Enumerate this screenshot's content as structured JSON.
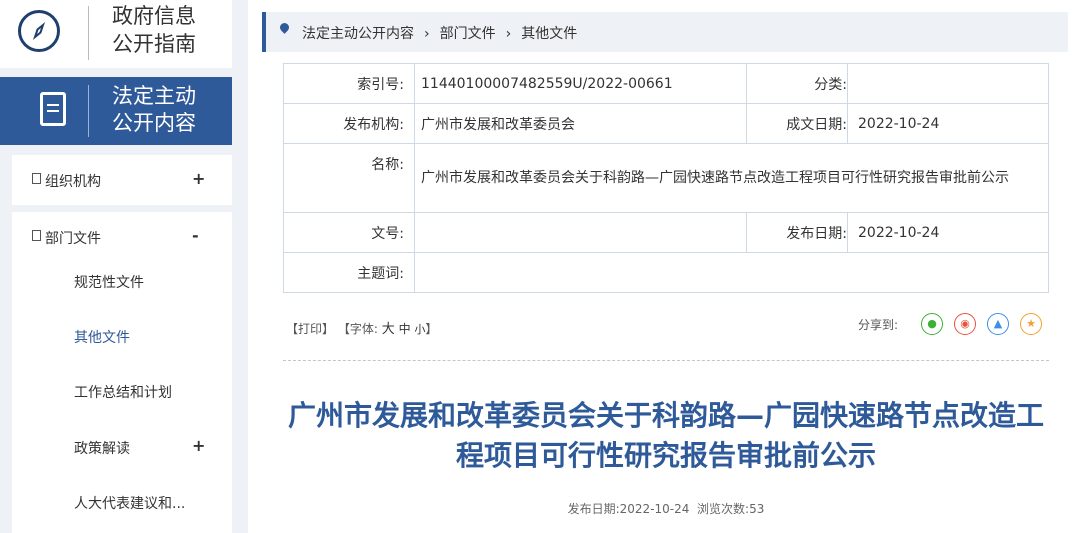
{
  "sidebar": {
    "guide_label": [
      "政府信息",
      "公开指南"
    ],
    "active_label": [
      "法定主动",
      "公开内容"
    ],
    "menu": [
      {
        "label": "组织机构",
        "sign": "+"
      },
      {
        "label": "部门文件",
        "sign": "-"
      }
    ],
    "submenu": [
      {
        "label": "规范性文件"
      },
      {
        "label": "其他文件"
      },
      {
        "label": "工作总结和计划"
      },
      {
        "label": "政策解读",
        "sign": "+"
      },
      {
        "label": "人大代表建议和..."
      }
    ]
  },
  "breadcrumb": [
    "法定主动公开内容",
    "部门文件",
    "其他文件"
  ],
  "meta": {
    "index_label": "索引号:",
    "index_value": "11440100007482559U/2022-00661",
    "category_label": "分类:",
    "category_value": "",
    "publisher_label": "发布机构:",
    "publisher_value": "广州市发展和改革委员会",
    "written_date_label": "成文日期:",
    "written_date_value": "2022-10-24",
    "name_label": "名称:",
    "name_value": "广州市发展和改革委员会关于科韵路—广园快速路节点改造工程项目可行性研究报告审批前公示",
    "doc_no_label": "文号:",
    "doc_no_value": "",
    "publish_date_label": "发布日期:",
    "publish_date_value": "2022-10-24",
    "keywords_label": "主题词:",
    "keywords_value": ""
  },
  "toolbar": {
    "print": "【打印】",
    "font_prefix": "【字体:",
    "font_large": "大",
    "font_medium": "中",
    "font_small": "小",
    "font_suffix": "】",
    "share_label": "分享到:"
  },
  "share_icons": [
    "wechat-icon",
    "weibo-icon",
    "qq-icon",
    "qzone-icon"
  ],
  "article": {
    "title": "广州市发展和改革委员会关于科韵路—广园快速路节点改造工程项目可行性研究报告审批前公示",
    "pub_date_label": "发布日期:",
    "pub_date": "2022-10-24",
    "views_label": "浏览次数:",
    "views": "53"
  },
  "colors": {
    "primary": "#2f5a99",
    "sidebar_bg": "#eef1f5",
    "wechat": "#3cb034",
    "weibo": "#e8543a",
    "qq": "#3d8ee8",
    "qzone": "#f0a22e"
  }
}
